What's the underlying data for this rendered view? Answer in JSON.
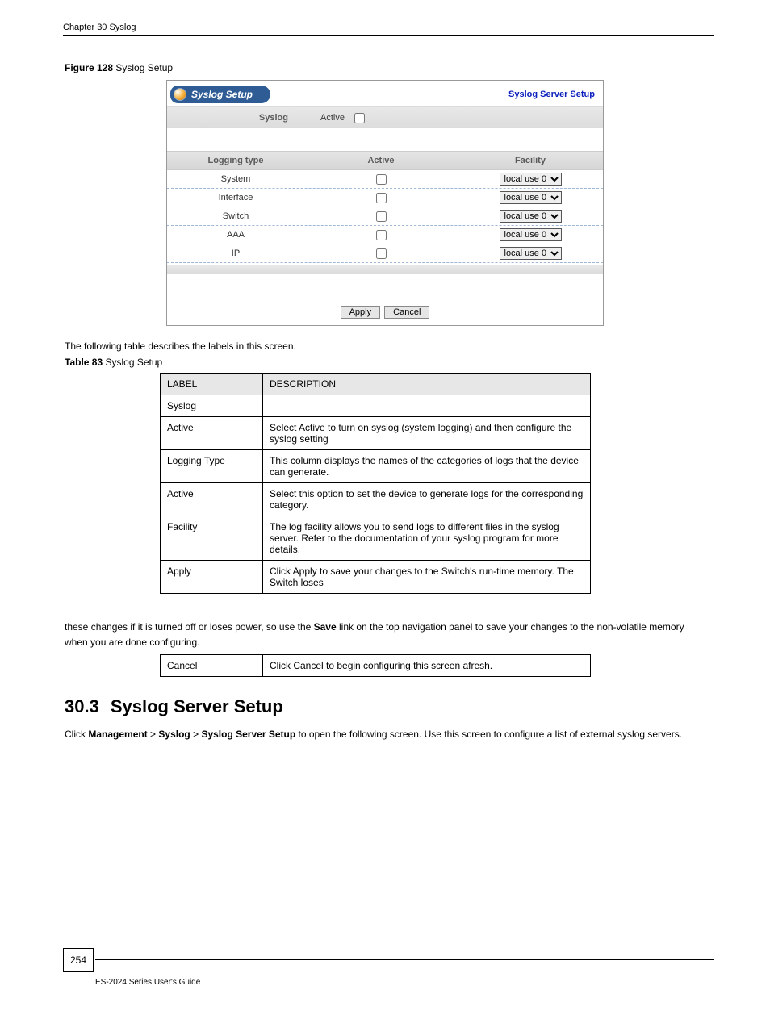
{
  "header": {
    "left": "Chapter 30 Syslog",
    "right": ""
  },
  "figure_caption_prefix": "Figure 128   ",
  "figure_caption": "Syslog Setup",
  "ui": {
    "title": "Syslog Setup",
    "server_link": "Syslog Server Setup",
    "syslog_label": "Syslog",
    "active_label": "Active",
    "columns": {
      "type": "Logging type",
      "active": "Active",
      "facility": "Facility"
    },
    "rows": [
      {
        "type": "System",
        "facility": "local use 0"
      },
      {
        "type": "Interface",
        "facility": "local use 0"
      },
      {
        "type": "Switch",
        "facility": "local use 0"
      },
      {
        "type": "AAA",
        "facility": "local use 0"
      },
      {
        "type": "IP",
        "facility": "local use 0"
      }
    ],
    "apply": "Apply",
    "cancel": "Cancel"
  },
  "desc_intro": "The following table describes the labels in this screen.",
  "desc_caption_prefix": "Table 83   ",
  "desc_caption": "Syslog Setup",
  "desc_table": {
    "head": {
      "label": "LABEL",
      "desc": "DESCRIPTION"
    },
    "rows": [
      {
        "label": "Syslog",
        "desc": ""
      },
      {
        "label": "Active",
        "desc": "Select Active to turn on syslog (system logging) and then configure the syslog setting"
      },
      {
        "label": "Logging Type",
        "desc": "This column displays the names of the categories of logs that the device can generate."
      },
      {
        "label": "Active",
        "desc": "Select this option to set the device to generate logs for the corresponding category."
      },
      {
        "label": "Facility",
        "desc": "The log facility allows you to send logs to different files in the syslog server. Refer to the documentation of your syslog program for more details."
      },
      {
        "label": "Apply",
        "desc": "Click Apply to save your changes to the Switch's run-time memory. The Switch loses"
      }
    ]
  },
  "after_note_parts": [
    "these changes if it is turned off or loses power, so use the ",
    "Save",
    " link on the top navigation panel to save your changes to the non-volatile memory when you are done configuring."
  ],
  "cancel_row": {
    "label": "Cancel",
    "desc": "Click Cancel to begin configuring this screen afresh."
  },
  "section": {
    "num": "30.3",
    "title": "Syslog Server Setup"
  },
  "config_intro_parts": [
    "Click ",
    "Management",
    " > ",
    "Syslog",
    " > ",
    "Syslog Server Setup",
    " to open the following screen. Use this screen to configure a list of external syslog servers."
  ],
  "footer": {
    "page": "254",
    "guide": "ES-2024 Series User's Guide"
  }
}
